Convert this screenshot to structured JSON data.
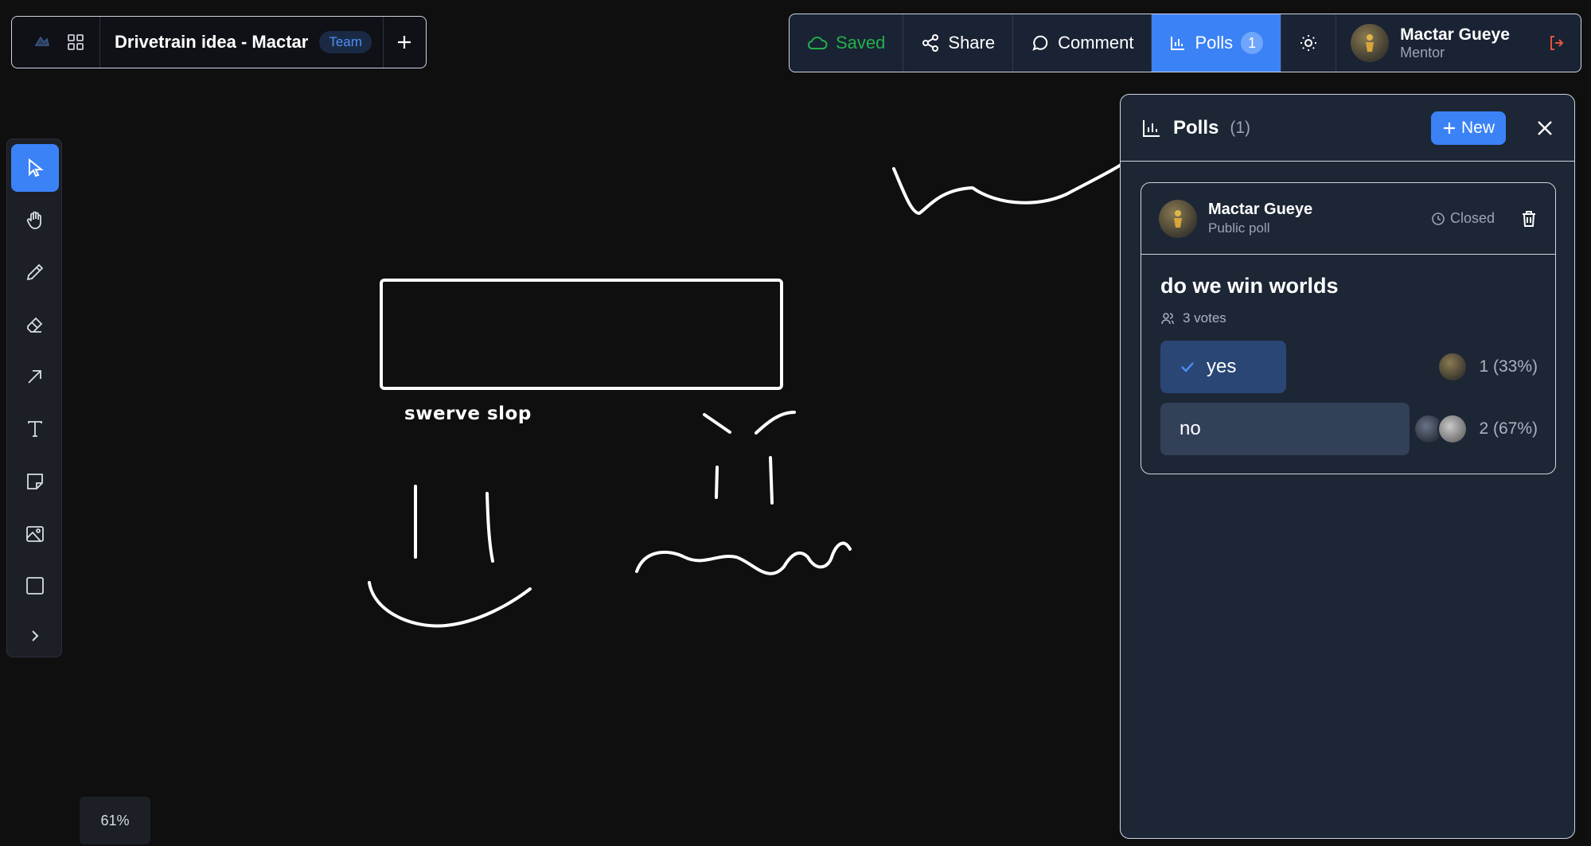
{
  "doc": {
    "title": "Drivetrain idea - Mactar",
    "badge": "Team"
  },
  "toolbar_top": {
    "saved": "Saved",
    "share": "Share",
    "comment": "Comment",
    "polls": "Polls",
    "polls_count": "1"
  },
  "user": {
    "name": "Mactar Gueye",
    "role": "Mentor"
  },
  "canvas": {
    "label": "swerve slop",
    "zoom": "61%"
  },
  "panel": {
    "title": "Polls",
    "count": "(1)",
    "new_label": "New"
  },
  "poll": {
    "author": "Mactar Gueye",
    "visibility": "Public poll",
    "status": "Closed",
    "question": "do we win worlds",
    "votes": "3 votes",
    "options": [
      {
        "label": "yes",
        "result": "1 (33%)",
        "fraction": 0.33,
        "selected": true
      },
      {
        "label": "no",
        "result": "2 (67%)",
        "fraction": 0.67,
        "selected": false
      }
    ]
  },
  "colors": {
    "accent": "#3b82f6",
    "saved": "#22b04b",
    "logout": "#e5533d"
  }
}
